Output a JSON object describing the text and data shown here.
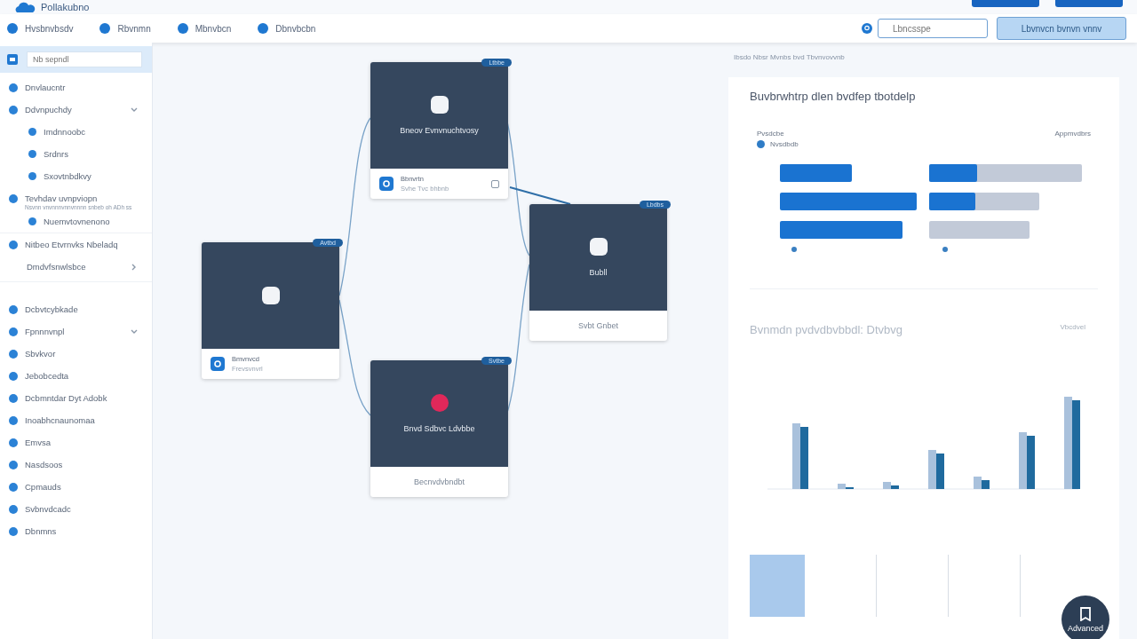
{
  "app": {
    "title": "Pollakubno"
  },
  "nav": [
    {
      "label": "Hvsbnvbsdv"
    },
    {
      "label": "Rbvnmn"
    },
    {
      "label": "Mbnvbcn"
    },
    {
      "label": "Dbnvbcbn"
    }
  ],
  "search": {
    "placeholder": "Lbncsspe"
  },
  "action_button": {
    "label": "Lbvnvcn bvnvn vnnv"
  },
  "sidebar": {
    "search": {
      "placeholder": "Nb sepndl",
      "selected": true
    },
    "items": [
      {
        "label": "Dnvlaucntr",
        "icon": true
      },
      {
        "label": "Ddvnpuchdy",
        "icon": true,
        "expanded": true,
        "children": [
          {
            "label": "Imdnnoobc",
            "icon": true
          },
          {
            "label": "Srdnrs",
            "icon": true
          },
          {
            "label": "Sxovtnbdkvy",
            "icon": true
          }
        ]
      },
      {
        "label": "Tevhdav uvnpviopn",
        "icon": true,
        "note": "Nsvnn vnvnnnvnnvnnnn snbeb oh ADh ss",
        "children": [
          {
            "label": "Nuemvtovnenono",
            "icon": true
          }
        ]
      },
      {
        "label": "Nitbeo Etvrnvks Nbeladq",
        "icon": true
      },
      {
        "label": "Dmdvfsnwlsbce",
        "icon": false,
        "expanded": false
      },
      {
        "label": "Dcbvtcybkade",
        "icon": true
      },
      {
        "label": "Fpnnnvnpl",
        "icon": true,
        "expanded": true
      },
      {
        "label": "Sbvkvor",
        "icon": true
      },
      {
        "label": "Jebobcedta",
        "icon": true
      },
      {
        "label": "Dcbmntdar Dyt Adobk",
        "icon": true
      },
      {
        "label": "Inoabhcnaunomaa",
        "icon": true
      },
      {
        "label": "Emvsa",
        "icon": true
      },
      {
        "label": "Nasdsoos",
        "icon": true
      },
      {
        "label": "Cpmauds",
        "icon": true
      },
      {
        "label": "Svbnvdcadc",
        "icon": true
      },
      {
        "label": "Dbnmns",
        "icon": true
      }
    ]
  },
  "nodes": [
    {
      "badge": "Avtbd",
      "kind": "normal",
      "footer": {
        "kind": "detail",
        "name": "Bmvnvcd",
        "sub": "Frevsvnvrl"
      }
    },
    {
      "badge": "Ltbbe",
      "kind": "normal",
      "title": "Bneov Evnvnuchtvosy",
      "footer": {
        "kind": "detail",
        "name": "Bbnvrtn",
        "sub": "Svhe Tvc bhbnb",
        "extra": true
      }
    },
    {
      "badge": "Lbdbs",
      "kind": "normal",
      "title": "Bubll",
      "footer": {
        "kind": "label",
        "text": "Svbt Gnbet"
      }
    },
    {
      "badge": "Svtbe",
      "kind": "alert",
      "title": "Bnvd Sdbvc Ldvbbe",
      "footer": {
        "kind": "label",
        "text": "Becnvdvbndbt"
      }
    }
  ],
  "panel": {
    "breadcrumb": "Ibsdo  Nbsr Mvnbs bvd Tbvnvovvnb",
    "card_title": "Buvbrwhtrp dlen bvdfep tbotdelp",
    "legend_title": "Pvsdcbe",
    "legend_item": "Nvsdbdb",
    "legend_right": "Appmvdbrs",
    "section_title": "Bvnmdn pvdvdbvbbdl: Dtvbvg",
    "section_right": "Vbcdvel"
  },
  "fab": {
    "label": "Advanced"
  }
}
